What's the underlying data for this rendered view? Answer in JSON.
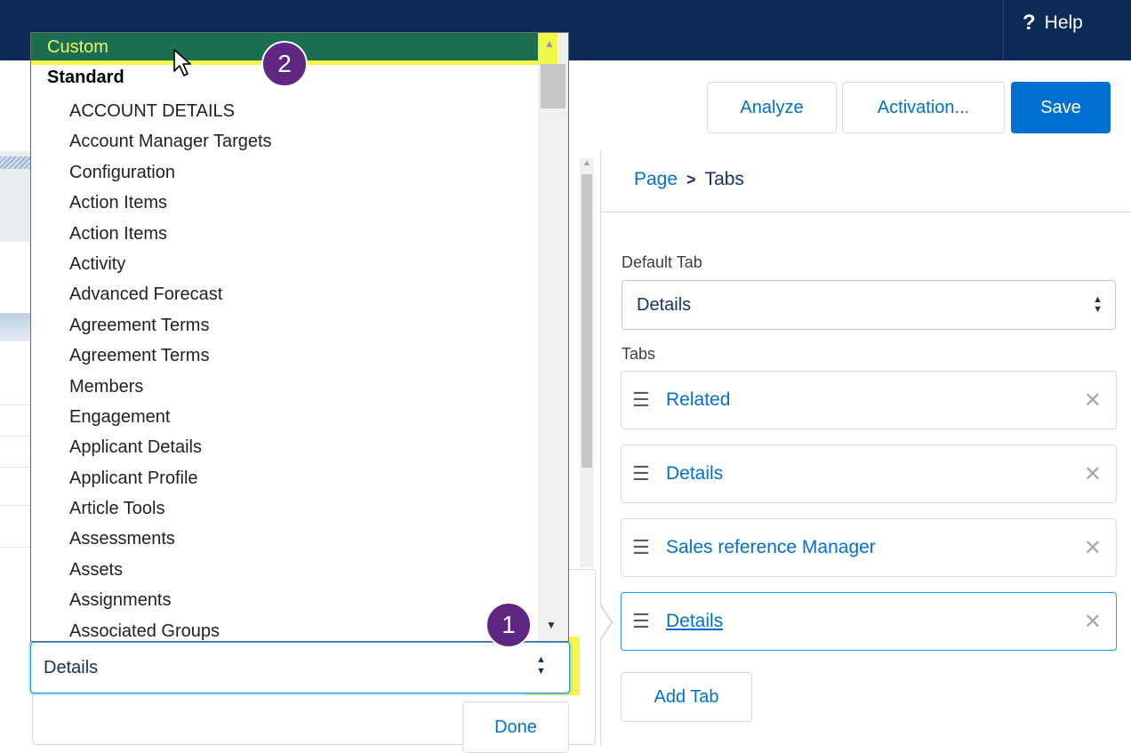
{
  "header": {
    "help_label": "Help",
    "help_icon_glyph": "?"
  },
  "toolbar": {
    "analyze_label": "Analyze",
    "activation_label": "Activation...",
    "save_label": "Save"
  },
  "breadcrumb": {
    "page": "Page",
    "separator": ">",
    "current": "Tabs"
  },
  "properties": {
    "default_tab_label": "Default Tab",
    "default_tab_value": "Details",
    "tabs_label": "Tabs",
    "tabs": [
      {
        "label": "Related"
      },
      {
        "label": "Details"
      },
      {
        "label": "Sales reference Manager"
      },
      {
        "label": "Details"
      }
    ],
    "add_tab_label": "Add Tab"
  },
  "popover": {
    "combo_value": "Details",
    "done_label": "Done"
  },
  "dropdown": {
    "selected_group": "Custom",
    "group_header": "Standard",
    "items": [
      "ACCOUNT DETAILS",
      "Account Manager Targets",
      "Configuration",
      "Action Items",
      "Action Items",
      "Activity",
      "Advanced Forecast",
      "Agreement Terms",
      "Agreement Terms",
      "Members",
      "Engagement",
      "Applicant Details",
      "Applicant Profile",
      "Article Tools",
      "Assessments",
      "Assets",
      "Assignments",
      "Associated Groups"
    ]
  },
  "callouts": {
    "one": "1",
    "two": "2"
  },
  "colors": {
    "header_bg": "#0b2a58",
    "brand_blue": "#0070d2",
    "selected_item_bg": "#1b6e4f",
    "highlight_yellow": "#f3f74a",
    "callout_purple": "#5f2781"
  }
}
